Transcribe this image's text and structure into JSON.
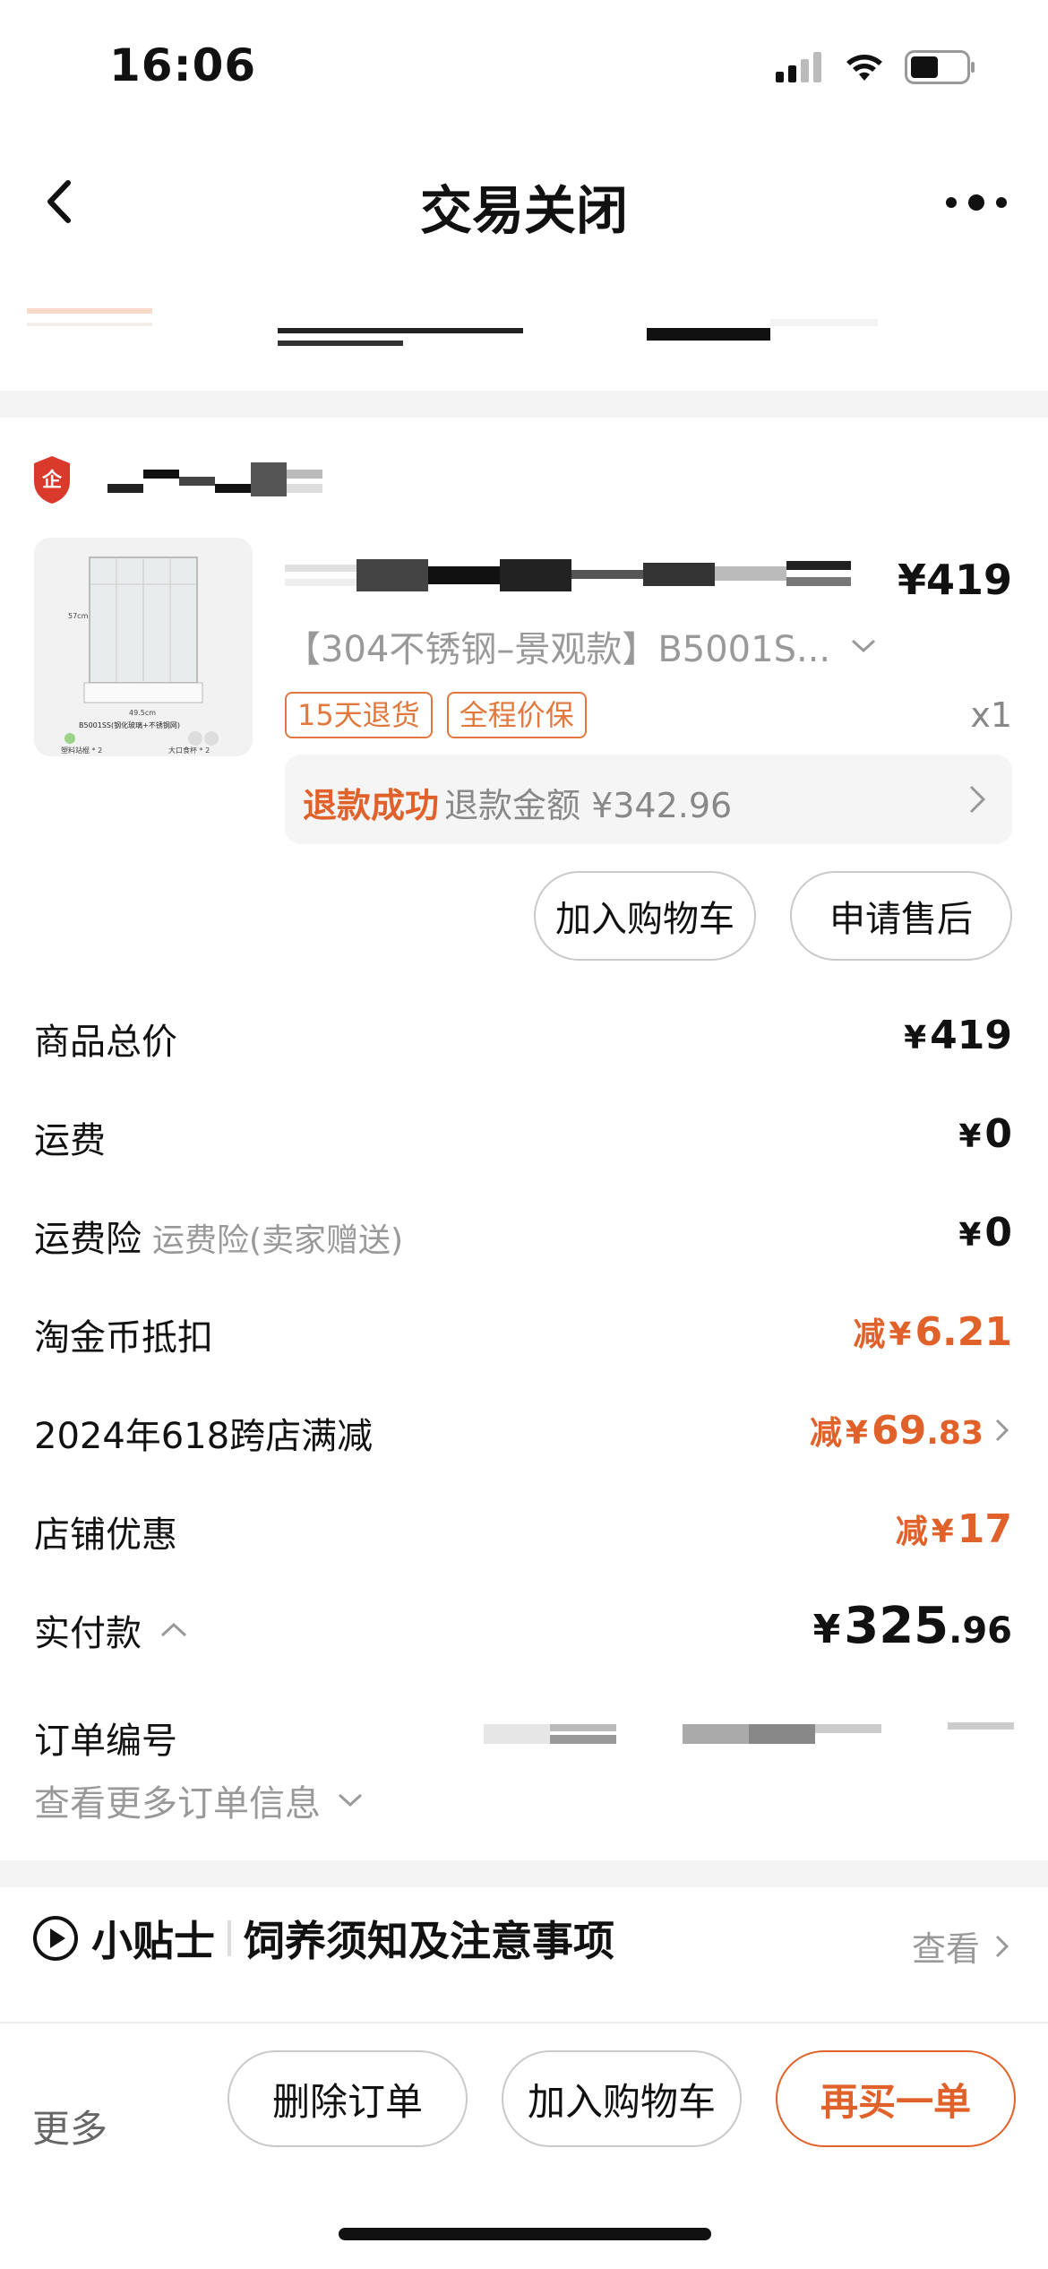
{
  "status_bar": {
    "time": "16:06"
  },
  "nav": {
    "title": "交易关闭"
  },
  "product": {
    "price": "¥419",
    "sku": "【304不锈钢–景观款】B5001S...",
    "tags": [
      "15天退货",
      "全程价保"
    ],
    "quantity": "x1",
    "image_labels": {
      "height": "57cm",
      "width": "49.5cm",
      "model": "B5001SS(钢化玻璃+不锈钢网)",
      "accessory1": "塑料站棍 * 2",
      "accessory2": "大口食杯 * 2"
    }
  },
  "refund": {
    "status": "退款成功",
    "amount_text": "退款金额 ¥342.96"
  },
  "actions": {
    "add_to_cart": "加入购物车",
    "after_sale": "申请售后"
  },
  "summary": {
    "items_total": {
      "label": "商品总价",
      "yen": "¥",
      "value": "419",
      "dec": ""
    },
    "shipping": {
      "label": "运费",
      "yen": "¥",
      "value": "0",
      "dec": ""
    },
    "shipping_insurance": {
      "label": "运费险",
      "sub": "运费险(卖家赠送)",
      "yen": "¥",
      "value": "0",
      "dec": ""
    },
    "coin_deduction": {
      "label": "淘金币抵扣",
      "prefix": "减",
      "yen": "¥",
      "value": "6.21",
      "dec": ""
    },
    "promo_618": {
      "label": "2024年618跨店满减",
      "prefix": "减",
      "yen": "¥",
      "value": "69",
      "dec": ".83"
    },
    "shop_discount": {
      "label": "店铺优惠",
      "prefix": "减",
      "yen": "¥",
      "value": "17",
      "dec": ""
    },
    "paid": {
      "label": "实付款",
      "yen": "¥",
      "value": "325",
      "dec": ".96"
    }
  },
  "order": {
    "number_label": "订单编号",
    "more_info": "查看更多订单信息"
  },
  "tips": {
    "title": "小贴士",
    "subtitle": "饲养须知及注意事项",
    "view": "查看"
  },
  "bottom": {
    "more": "更多",
    "delete": "删除订单",
    "add_to_cart": "加入购物车",
    "buy_again": "再买一单"
  },
  "colors": {
    "accent": "#e0622a",
    "tag": "#e1793f"
  }
}
